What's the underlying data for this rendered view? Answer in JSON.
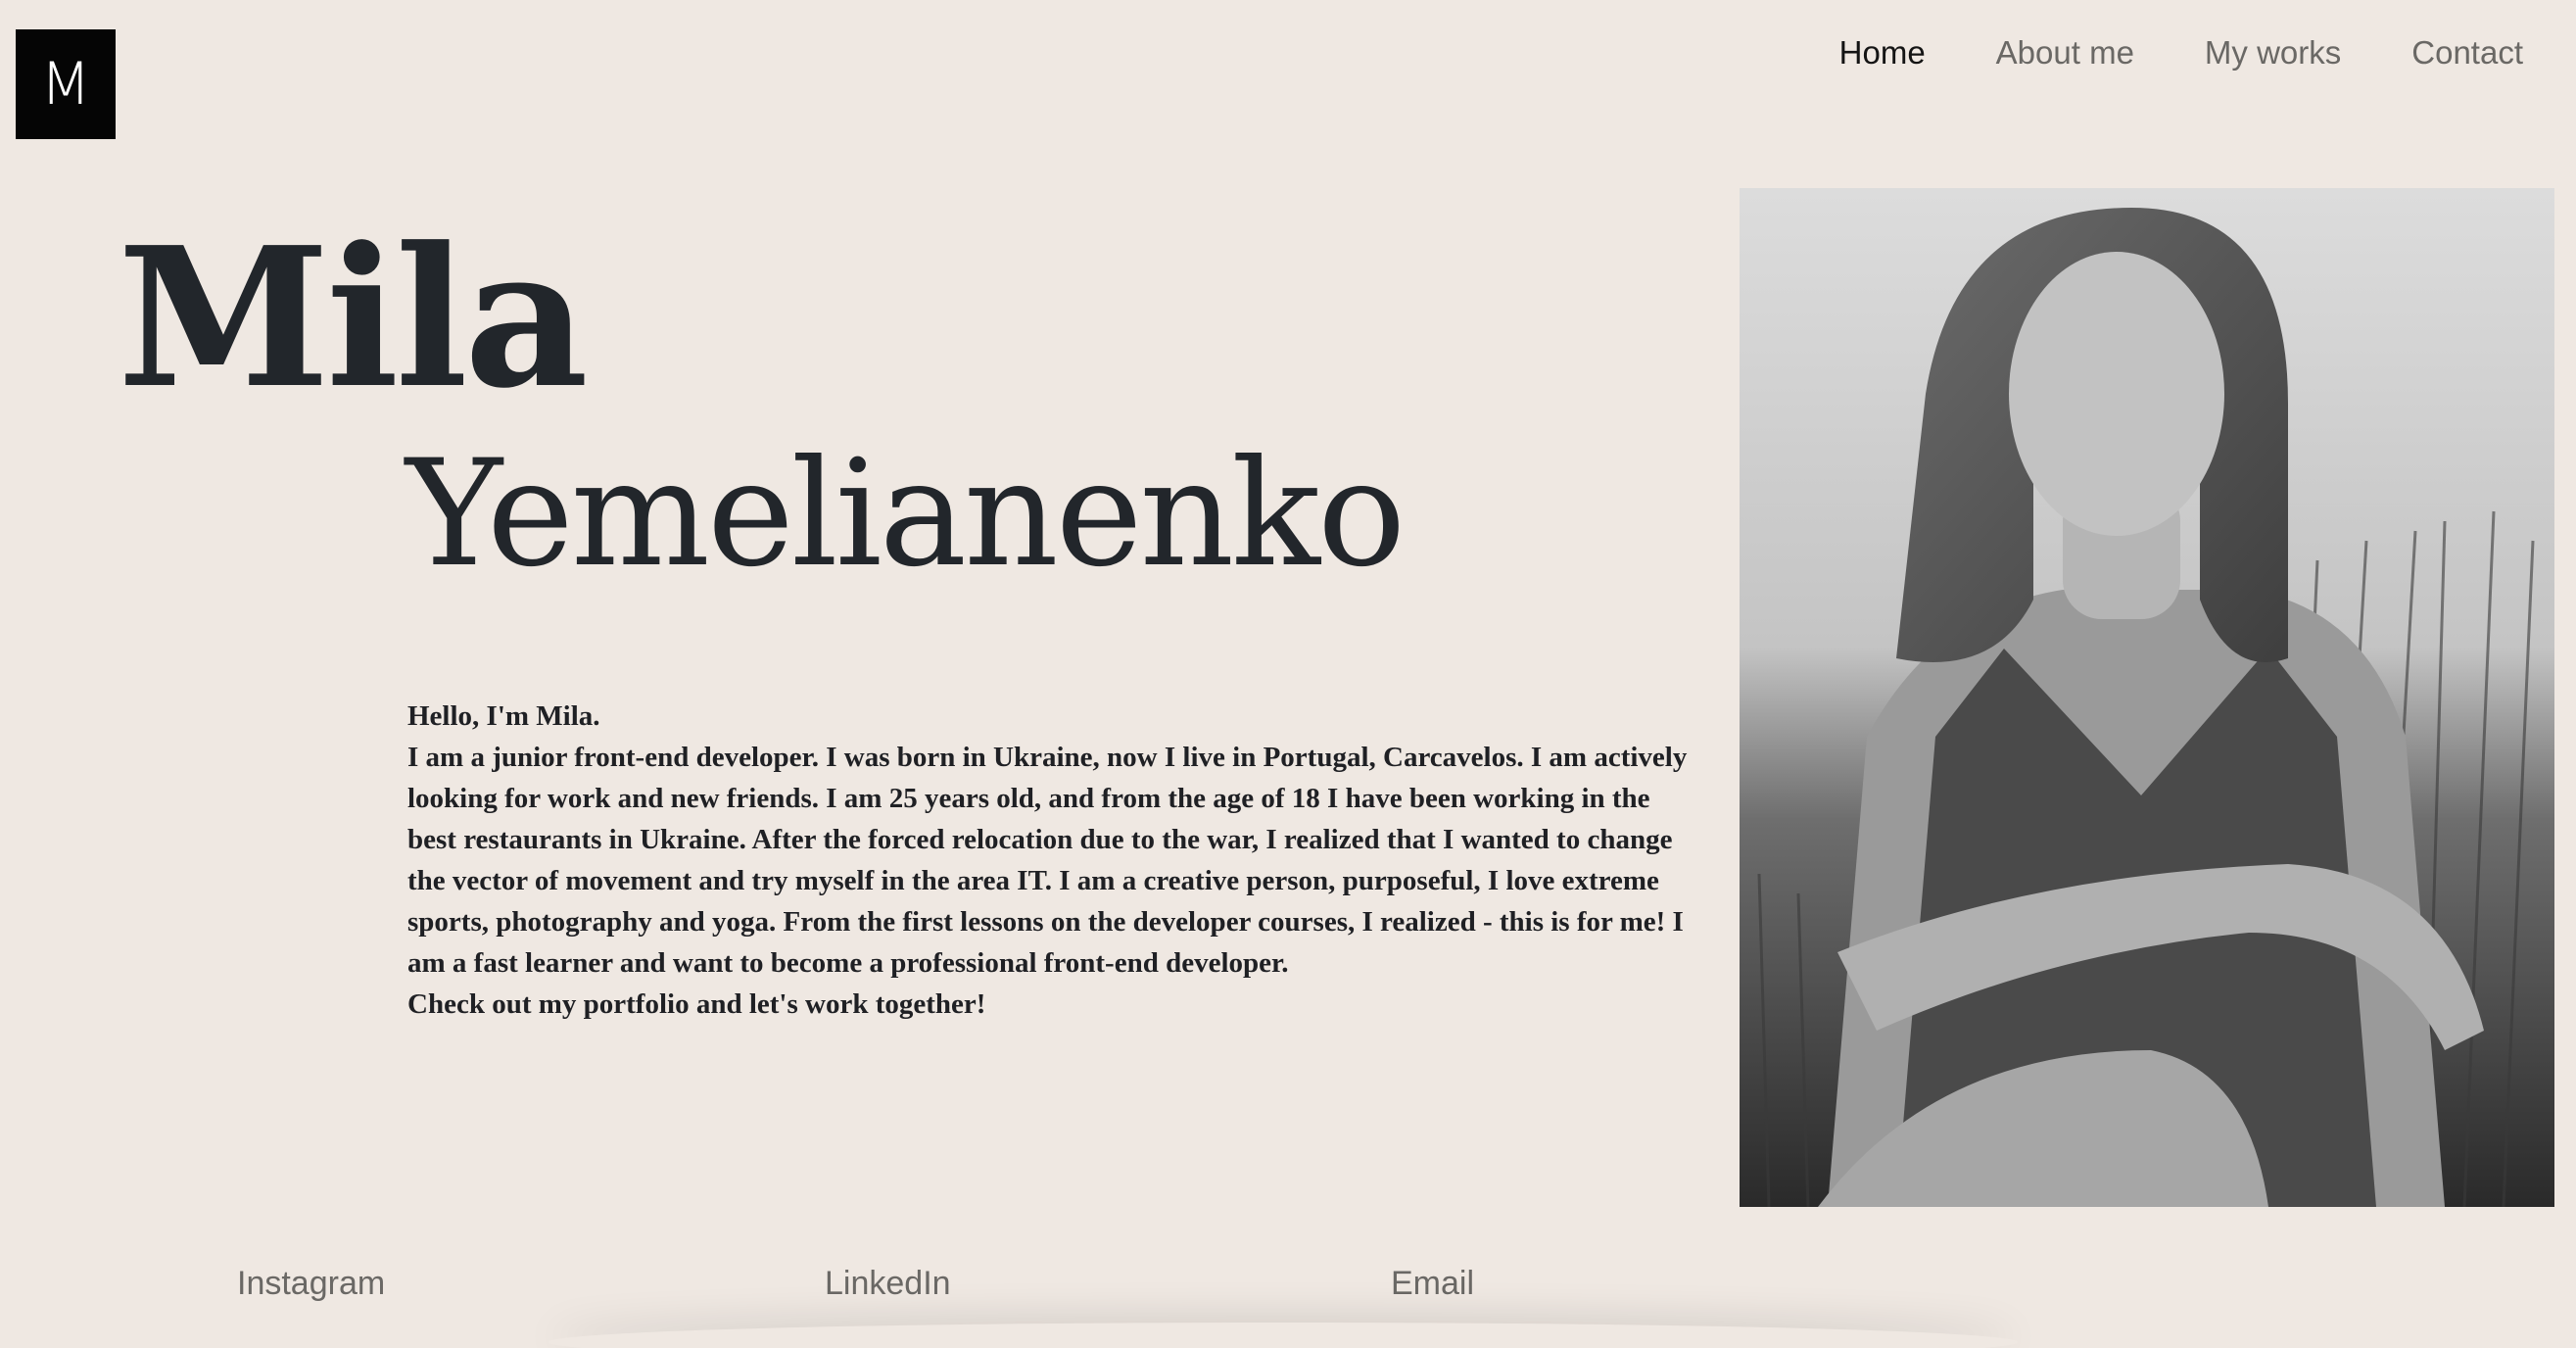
{
  "logo": {
    "letter": "M"
  },
  "nav": {
    "items": [
      {
        "label": "Home",
        "active": true
      },
      {
        "label": "About me",
        "active": false
      },
      {
        "label": "My works",
        "active": false
      },
      {
        "label": "Contact",
        "active": false
      }
    ]
  },
  "hero": {
    "first_name": "Mila",
    "last_name": "Yemelianenko"
  },
  "bio": {
    "greeting": "Hello, I'm Mila.",
    "paragraph": "I am a junior front-end developer. I was born in Ukraine, now I live in Portugal, Carcavelos. I am actively looking for work and new friends. I am 25 years old, and from the age of 18 I have been working in the best restaurants in Ukraine. After the forced relocation due to the war, I realized that I wanted to change the vector of movement and try myself in the area IT. I am a creative person, purposeful, I love extreme sports, photography and yoga. From the first lessons on the developer courses, I realized - this is for me! I am a fast learner and want to become a professional front-end developer.",
    "cta": "Check out my portfolio and let's work together!"
  },
  "social": {
    "instagram": "Instagram",
    "linkedin": "LinkedIn",
    "email": "Email"
  },
  "colors": {
    "background": "#efe8e2",
    "heading": "#22262b",
    "nav_text": "#6a6865",
    "nav_active": "#141414",
    "logo_bg": "#050505"
  }
}
